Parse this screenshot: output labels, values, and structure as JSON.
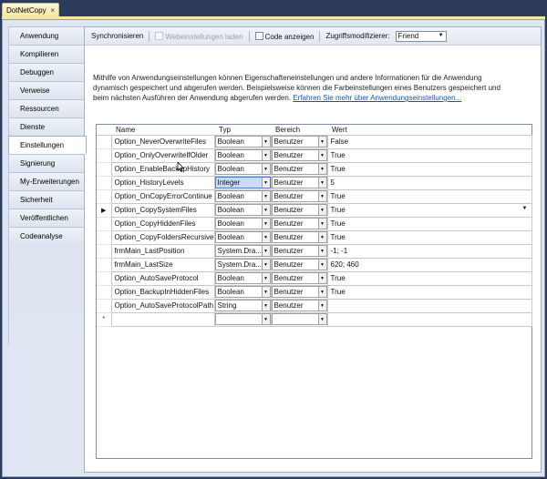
{
  "window": {
    "doc_tab": "DotNetCopy",
    "doc_tab_close": "×"
  },
  "sidebar": {
    "items": [
      {
        "label": "Anwendung"
      },
      {
        "label": "Kompilieren"
      },
      {
        "label": "Debuggen"
      },
      {
        "label": "Verweise"
      },
      {
        "label": "Ressourcen"
      },
      {
        "label": "Dienste"
      },
      {
        "label": "Einstellungen",
        "active": true
      },
      {
        "label": "Signierung"
      },
      {
        "label": "My-Erweiterungen"
      },
      {
        "label": "Sicherheit"
      },
      {
        "label": "Veröffentlichen"
      },
      {
        "label": "Codeanalyse"
      }
    ]
  },
  "toolbar": {
    "sync": "Synchronisieren",
    "web": "Webeinstellungen laden",
    "code": "Code anzeigen",
    "modifier_label": "Zugriffsmodifizierer:",
    "modifier_value": "Friend"
  },
  "description": {
    "text": "Mithilfe von Anwendungseinstellungen können Eigenschafteneinstellungen und andere Informationen für die Anwendung dynamisch gespeichert und abgerufen werden. Beispielsweise können die Farbeinstellungen eines Benutzers gespeichert und beim nächsten Ausführen der Anwendung abgerufen werden.",
    "link": "Erfahren Sie mehr über Anwendungseinstellungen..."
  },
  "grid": {
    "columns": {
      "name": "Name",
      "type": "Typ",
      "scope": "Bereich",
      "value": "Wert"
    },
    "current_marker": "▶",
    "new_marker": "*",
    "rows": [
      {
        "name": "Option_NeverOverwriteFiles",
        "type": "Boolean",
        "scope": "Benutzer",
        "value": "False"
      },
      {
        "name": "Option_OnlyOverwriteIfOlder",
        "type": "Boolean",
        "scope": "Benutzer",
        "value": "True"
      },
      {
        "name": "Option_EnableBackupHistory",
        "type": "Boolean",
        "scope": "Benutzer",
        "value": "True"
      },
      {
        "name": "Option_HistoryLevels",
        "type": "Integer",
        "scope": "Benutzer",
        "value": "5"
      },
      {
        "name": "Option_OnCopyErrorContinue",
        "type": "Boolean",
        "scope": "Benutzer",
        "value": "True"
      },
      {
        "name": "Option_CopySystemFiles",
        "type": "Boolean",
        "scope": "Benutzer",
        "value": "True"
      },
      {
        "name": "Option_CopyHiddenFiles",
        "type": "Boolean",
        "scope": "Benutzer",
        "value": "True"
      },
      {
        "name": "Option_CopyFoldersRecursive",
        "type": "Boolean",
        "scope": "Benutzer",
        "value": "True"
      },
      {
        "name": "frmMain_LastPosition",
        "type": "System.Dra...",
        "scope": "Benutzer",
        "value": "-1; -1"
      },
      {
        "name": "frmMain_LastSize",
        "type": "System.Dra...",
        "scope": "Benutzer",
        "value": "620; 460"
      },
      {
        "name": "Option_AutoSaveProtocol",
        "type": "Boolean",
        "scope": "Benutzer",
        "value": "True"
      },
      {
        "name": "Option_BackupInHiddenFiles",
        "type": "Boolean",
        "scope": "Benutzer",
        "value": "True"
      },
      {
        "name": "Option_AutoSaveProtocolPath",
        "type": "String",
        "scope": "Benutzer",
        "value": ""
      }
    ]
  }
}
